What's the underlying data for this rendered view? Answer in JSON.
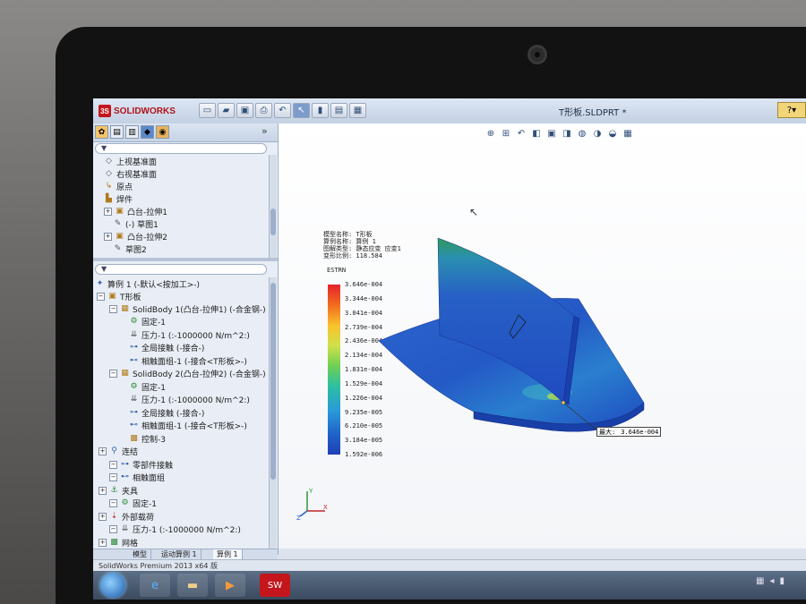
{
  "window": {
    "brand": "SOLIDWORKS",
    "title": "T形板.SLDPRT *"
  },
  "laptop": {
    "brand": ""
  },
  "feature_tree": [
    {
      "label": "上视基准面",
      "icon": "plane-icon"
    },
    {
      "label": "右视基准面",
      "icon": "plane-icon"
    },
    {
      "label": "原点",
      "icon": "origin-icon"
    },
    {
      "label": "焊件",
      "icon": "weldment-icon"
    },
    {
      "label": "凸台-拉伸1",
      "icon": "extrude-icon"
    },
    {
      "label": "(-) 草图1",
      "icon": "sketch-icon"
    },
    {
      "label": "凸台-拉伸2",
      "icon": "extrude-icon"
    },
    {
      "label": "草图2",
      "icon": "sketch-icon"
    }
  ],
  "study_tree": {
    "root": "算例 1 (-默认<按加工>-)",
    "part": "T形板",
    "items": [
      {
        "label": "SolidBody 1(凸台-拉伸1) (-合金钢-)",
        "level": 1,
        "icon": "solid-body-icon"
      },
      {
        "label": "固定-1",
        "level": 2,
        "icon": "fixture-icon"
      },
      {
        "label": "压力-1 (:-1000000 N/m^2:)",
        "level": 2,
        "icon": "pressure-icon"
      },
      {
        "label": "全局接触 (-接合-)",
        "level": 2,
        "icon": "contact-icon"
      },
      {
        "label": "相触面组-1 (-接合<T形板>-)",
        "level": 2,
        "icon": "contact-set-icon"
      },
      {
        "label": "SolidBody 2(凸台-拉伸2) (-合金钢-)",
        "level": 1,
        "icon": "solid-body-icon"
      },
      {
        "label": "固定-1",
        "level": 2,
        "icon": "fixture-icon"
      },
      {
        "label": "压力-1 (:-1000000 N/m^2:)",
        "level": 2,
        "icon": "pressure-icon"
      },
      {
        "label": "全局接触 (-接合-)",
        "level": 2,
        "icon": "contact-icon"
      },
      {
        "label": "相触面组-1 (-接合<T形板>-)",
        "level": 2,
        "icon": "contact-set-icon"
      },
      {
        "label": "控制-3",
        "level": 2,
        "icon": "mesh-control-icon"
      },
      {
        "label": "连结",
        "level": 0,
        "icon": "connections-icon"
      },
      {
        "label": "零部件接触",
        "level": 1,
        "icon": "component-contact-icon"
      },
      {
        "label": "相触面组",
        "level": 1,
        "icon": "contact-set-icon"
      },
      {
        "label": "夹具",
        "level": 0,
        "icon": "fixtures-icon"
      },
      {
        "label": "固定-1",
        "level": 1,
        "icon": "fixture-icon"
      },
      {
        "label": "外部载荷",
        "level": 0,
        "icon": "external-loads-icon"
      },
      {
        "label": "压力-1 (:-1000000 N/m^2:)",
        "level": 1,
        "icon": "pressure-icon"
      },
      {
        "label": "网格",
        "level": 0,
        "icon": "mesh-icon"
      }
    ]
  },
  "bottom_tabs": [
    "模型",
    "运动算例 1",
    "算例 1"
  ],
  "status_text": "SolidWorks Premium 2013 x64 版",
  "plot": {
    "info_lines": [
      "模型名称: T形板",
      "算例名称: 算例 1",
      "图解类型: 静态应变 应变1",
      "变形比例: 118.584"
    ],
    "legend_title": "ESTRN",
    "legend_values": [
      "3.646e-004",
      "3.344e-004",
      "3.041e-004",
      "2.739e-004",
      "2.436e-004",
      "2.134e-004",
      "1.831e-004",
      "1.529e-004",
      "1.226e-004",
      "9.235e-005",
      "6.210e-005",
      "3.184e-005",
      "1.592e-006"
    ],
    "max_label": "最大:",
    "max_value": "3.646e-004"
  },
  "colors": {
    "accent": "#c4161c",
    "viewport_bg": "#ffffff",
    "model_blue": "#1f4fc4"
  }
}
